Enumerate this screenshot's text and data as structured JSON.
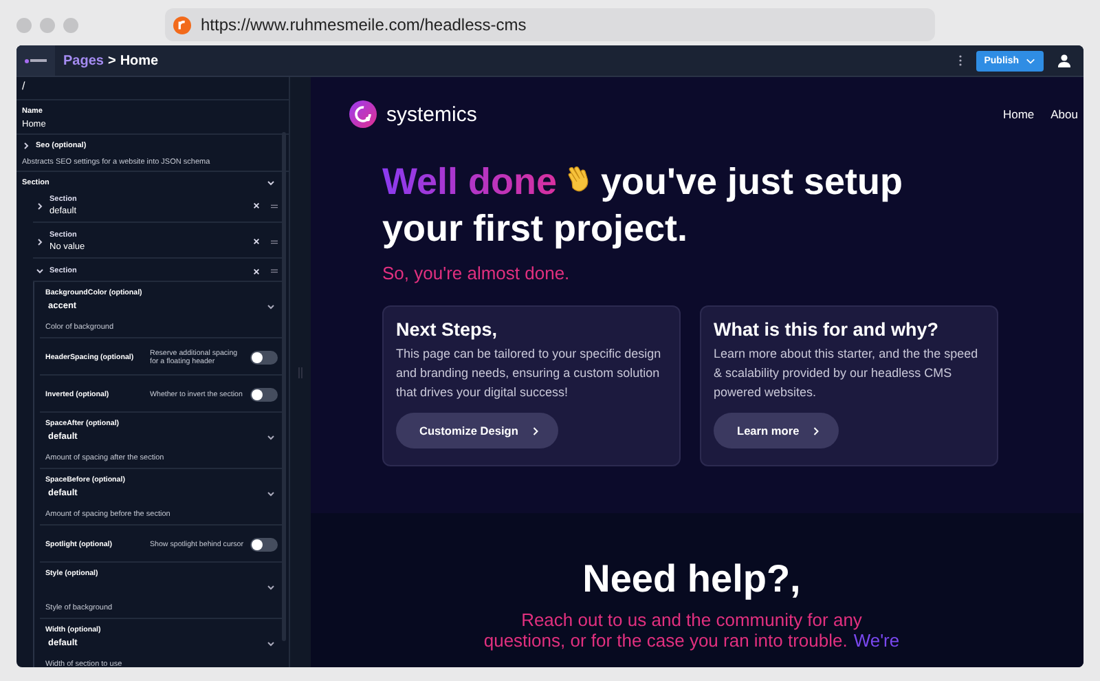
{
  "browser": {
    "url": "https://www.ruhmesmeile.com/headless-cms"
  },
  "header": {
    "breadcrumb": {
      "parent": "Pages",
      "separator": ">",
      "current": "Home"
    },
    "publish": "Publish"
  },
  "editor": {
    "path": "/",
    "name": {
      "label": "Name",
      "value": "Home"
    },
    "seo": {
      "label": "Seo (optional)",
      "expanded": false,
      "description": "Abstracts SEO settings for a website into JSON schema"
    },
    "sections": {
      "label": "Section",
      "expanded": true,
      "items": [
        {
          "label": "Section",
          "value": "default",
          "expanded": false
        },
        {
          "label": "Section",
          "value": "No value",
          "expanded": false
        },
        {
          "label": "Section",
          "expanded": true,
          "fields": [
            {
              "kind": "select",
              "label": "BackgroundColor (optional)",
              "value": "accent",
              "help": "Color of background"
            },
            {
              "kind": "toggle",
              "label": "HeaderSpacing (optional)",
              "help": "Reserve additional spacing for a floating header",
              "on": false
            },
            {
              "kind": "toggle",
              "label": "Inverted (optional)",
              "help": "Whether to invert the section",
              "on": false
            },
            {
              "kind": "select",
              "label": "SpaceAfter (optional)",
              "value": "default",
              "help": "Amount of spacing after the section"
            },
            {
              "kind": "select",
              "label": "SpaceBefore (optional)",
              "value": "default",
              "help": "Amount of spacing before the section"
            },
            {
              "kind": "toggle",
              "label": "Spotlight (optional)",
              "help": "Show spotlight behind cursor",
              "on": false
            },
            {
              "kind": "select",
              "label": "Style (optional)",
              "help": "Style of background"
            },
            {
              "kind": "select",
              "label": "Width (optional)",
              "value": "default",
              "help": "Width of section to use"
            }
          ]
        }
      ]
    }
  },
  "preview": {
    "brand": "systemics",
    "nav": [
      {
        "label": "Home"
      },
      {
        "label": "Abou"
      }
    ],
    "hero": {
      "highlight": "Well done",
      "heading_line_1": "you've just setup",
      "heading_line_2": "your first project.",
      "subtitle": "So, you're almost done."
    },
    "cards": [
      {
        "title": "Next Steps,",
        "text": "This page can be tailored to your specific design and branding needs, ensuring a custom solution that drives your digital success!",
        "button": "Customize Design"
      },
      {
        "title": "What is this for and why?",
        "text": "Learn more about this starter, and the the speed & scalability provided by our headless CMS powered websites.",
        "button": "Learn more"
      }
    ],
    "help": {
      "title": "Need help?,",
      "line_1": "Reach out to us and the community for any",
      "line_2": "questions, or for the case you ran into trouble.",
      "link": "We're"
    }
  }
}
